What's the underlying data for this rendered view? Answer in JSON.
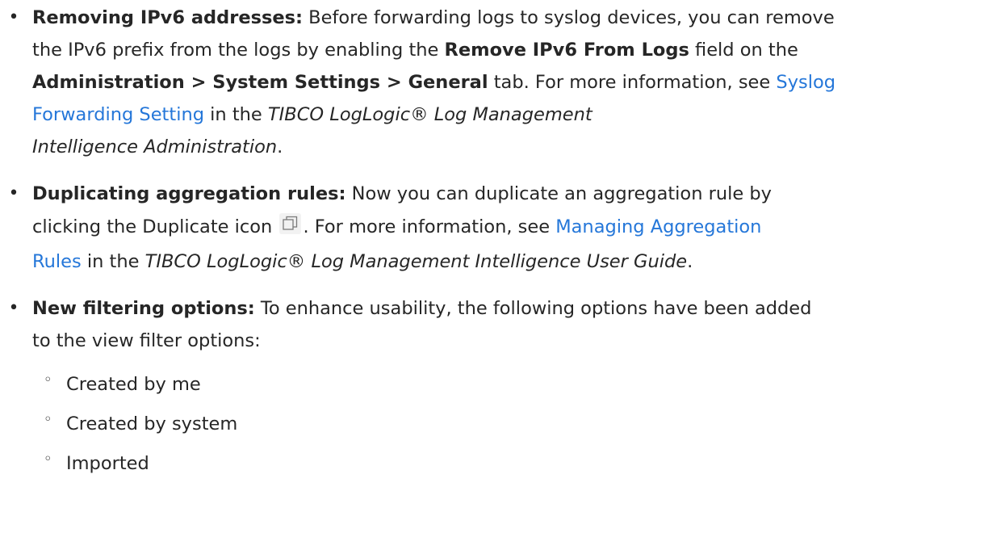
{
  "items": [
    {
      "term": "Removing IPv6 addresses:",
      "t1": " Before forwarding logs to syslog devices, you can remove",
      "t2": "the IPv6 prefix from the logs by enabling the ",
      "ui1": "Remove IPv6 From Logs",
      "t3": " field on the",
      "ui2": "Administration > System Settings > General",
      "t4": " tab. For more information, see ",
      "link1": "Syslog",
      "link2": "Forwarding Setting",
      "t5": " in the ",
      "ital1": "TIBCO LogLogic® Log Management",
      "ital2": "Intelligence Administration",
      "t6": "."
    },
    {
      "term": "Duplicating aggregation rules:",
      "t1": " Now you can duplicate an aggregation rule by",
      "t2": "clicking the Duplicate icon ",
      "t3": ". For more information, see ",
      "link1": "Managing Aggregation",
      "link2": "Rules",
      "t4": " in the ",
      "ital1": "TIBCO LogLogic® Log Management Intelligence User Guide",
      "t5": "."
    },
    {
      "term": "New filtering options:",
      "t1": " To enhance usability, the following options have been added",
      "t2": "to the view filter options:",
      "sub": [
        "Created by me",
        "Created by system",
        "Imported"
      ]
    }
  ],
  "icons": {
    "bullet": "•",
    "sub_bullet": "◦",
    "duplicate": "duplicate-icon"
  },
  "colors": {
    "link": "#2577d9",
    "text": "#262626"
  }
}
